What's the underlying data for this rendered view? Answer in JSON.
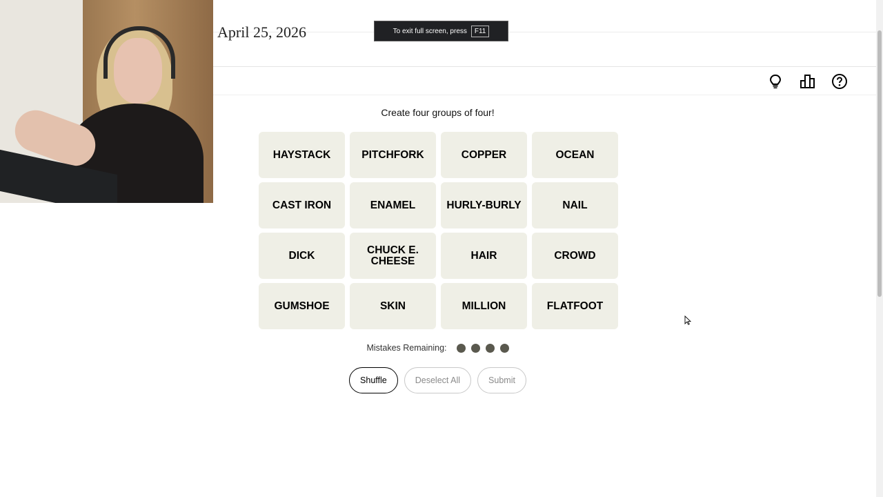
{
  "header": {
    "date": "April 25, 2026"
  },
  "toast": {
    "text": "To exit full screen, press",
    "key": "F11"
  },
  "toolbar": {
    "icons": [
      "lightbulb-icon",
      "leaderboard-icon",
      "help-icon"
    ]
  },
  "game": {
    "instruction": "Create four groups of four!",
    "tiles": [
      "HAYSTACK",
      "PITCHFORK",
      "COPPER",
      "OCEAN",
      "CAST IRON",
      "ENAMEL",
      "HURLY-BURLY",
      "NAIL",
      "DICK",
      "CHUCK E. CHEESE",
      "HAIR",
      "CROWD",
      "GUMSHOE",
      "SKIN",
      "MILLION",
      "FLATFOOT"
    ],
    "mistakes_label": "Mistakes Remaining:",
    "mistakes_remaining": 4
  },
  "actions": {
    "shuffle": "Shuffle",
    "deselect_all": "Deselect All",
    "submit": "Submit"
  },
  "colors": {
    "tile_bg": "#efefe6",
    "dot": "#5a594e"
  }
}
